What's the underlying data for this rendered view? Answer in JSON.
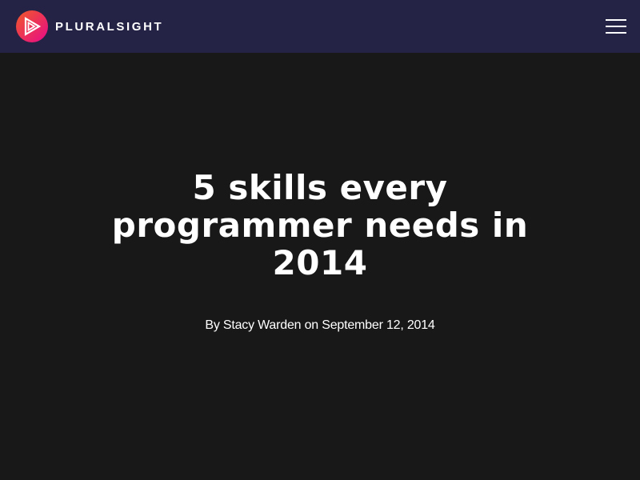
{
  "header": {
    "brand_name": "PLURALSIGHT",
    "logo_icon": "pluralsight-play-logo-icon",
    "menu_icon": "hamburger-menu-icon",
    "colors": {
      "background": "#242346",
      "logo_gradient_start": "#f05a28",
      "logo_gradient_end": "#e80a89"
    }
  },
  "article": {
    "title": "5 skills every programmer needs in 2014",
    "byline": "By Stacy Warden on September 12, 2014",
    "colors": {
      "background": "#181818",
      "text": "#ffffff"
    }
  }
}
